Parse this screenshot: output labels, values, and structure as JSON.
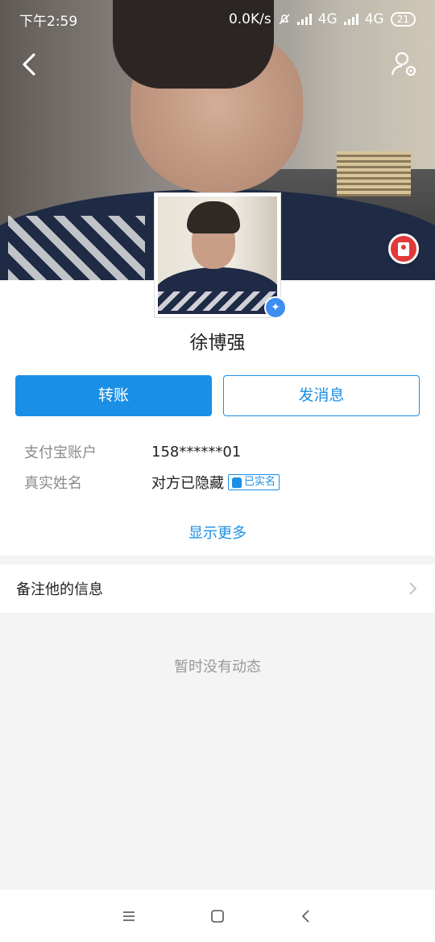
{
  "status_bar": {
    "time": "下午2:59",
    "network_speed": "0.0K/s",
    "signal_1": "4G",
    "signal_2": "4G",
    "battery": "21"
  },
  "header": {
    "back_icon": "chevron-left-icon",
    "profile_settings_icon": "user-settings-icon",
    "red_envelope_icon": "red-envelope-icon"
  },
  "profile": {
    "name": "徐博强",
    "verified_icon": "star-badge-icon"
  },
  "actions": {
    "transfer_label": "转账",
    "message_label": "发消息"
  },
  "info": {
    "account_label": "支付宝账户",
    "account_value": "158******01",
    "realname_label": "真实姓名",
    "realname_value": "对方已隐藏",
    "realname_badge": "已实名"
  },
  "show_more": "显示更多",
  "remark": {
    "label": "备注他的信息"
  },
  "feed": {
    "empty_text": "暂时没有动态"
  },
  "colors": {
    "accent": "#1b8fe6",
    "red": "#e23a3a"
  },
  "navbar": {
    "menu_icon": "menu-icon",
    "home_icon": "home-square-icon",
    "back_icon": "back-triangle-icon"
  }
}
